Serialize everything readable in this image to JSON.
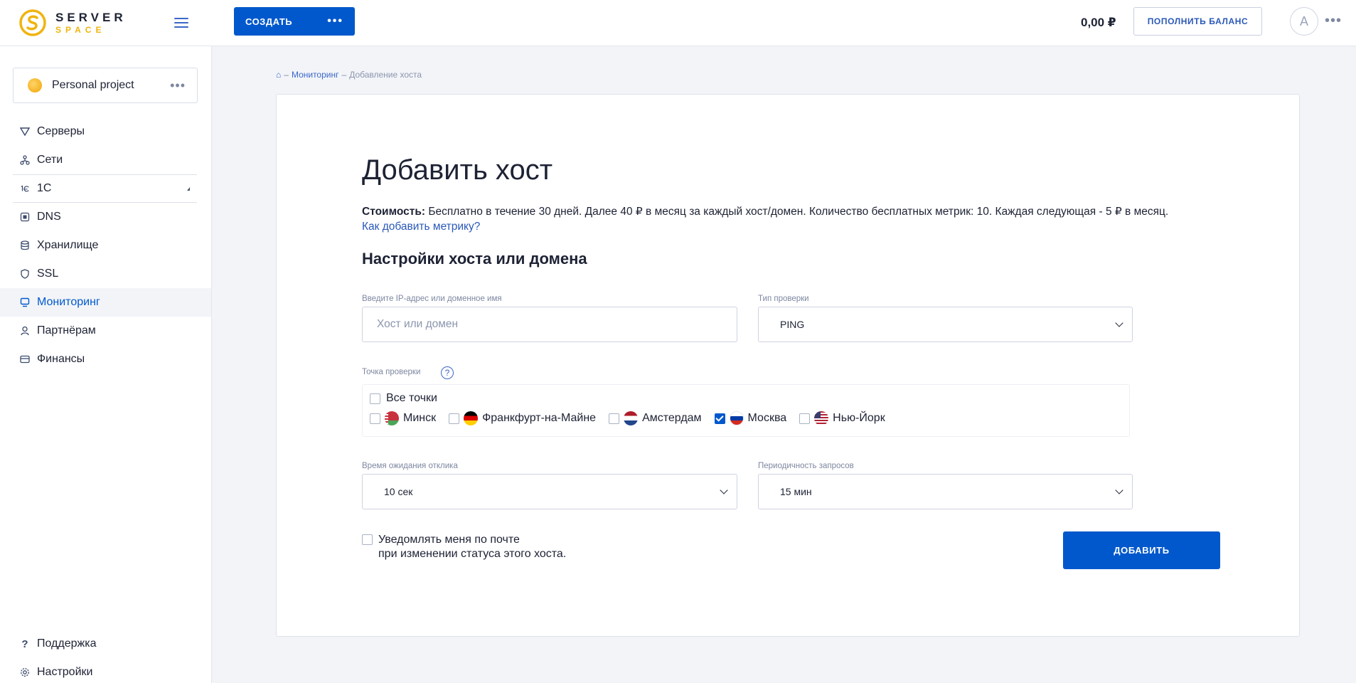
{
  "header": {
    "logo_top": "SERVER",
    "logo_bottom": "SPACE",
    "create_label": "СОЗДАТЬ",
    "create_more": "•••",
    "balance": "0,00 ₽",
    "topup_label": "ПОПОЛНИТЬ БАЛАНС",
    "avatar_letter": "A",
    "more": "•••"
  },
  "sidebar": {
    "project_name": "Personal project",
    "project_more": "•••",
    "items": [
      {
        "label": "Серверы",
        "icon": "servers-icon"
      },
      {
        "label": "Сети",
        "icon": "network-icon"
      },
      {
        "label": "1С",
        "icon": "1c-icon"
      },
      {
        "label": "DNS",
        "icon": "dns-icon"
      },
      {
        "label": "Хранилище",
        "icon": "storage-icon"
      },
      {
        "label": "SSL",
        "icon": "ssl-shield-icon"
      },
      {
        "label": "Мониторинг",
        "icon": "monitor-icon"
      },
      {
        "label": "Партнёрам",
        "icon": "partner-icon"
      },
      {
        "label": "Финансы",
        "icon": "card-icon"
      }
    ],
    "bottom_items": [
      {
        "label": "Поддержка",
        "icon": "help-icon"
      },
      {
        "label": "Настройки",
        "icon": "gear-icon"
      }
    ]
  },
  "breadcrumb": {
    "home_icon": "⌂",
    "sep": "–",
    "level1": "Мониторинг",
    "current": "Добавление хоста"
  },
  "main": {
    "title": "Добавить хост",
    "price_label": "Стоимость:",
    "price_text": " Бесплатно в течение 30 дней. Далее 40 ₽ в месяц за каждый хост/домен. Количество бесплатных метрик: 10. Каждая следующая - 5 ₽ в месяц.",
    "metric_link": "Как добавить метрику?",
    "section_title": "Настройки хоста или домена",
    "host_label": "Введите IP-адрес или доменное имя",
    "host_placeholder": "Хост или домен",
    "check_type_label": "Тип проверки",
    "check_type_value": "PING",
    "points_label": "Точка проверки",
    "help_glyph": "?",
    "all_points": "Все точки",
    "points": [
      {
        "label": "Минск",
        "flag": "flag-by",
        "checked": false
      },
      {
        "label": "Франкфурт-на-Майне",
        "flag": "flag-de",
        "checked": false
      },
      {
        "label": "Амстердам",
        "flag": "flag-nl",
        "checked": false
      },
      {
        "label": "Москва",
        "flag": "flag-ru",
        "checked": true
      },
      {
        "label": "Нью-Йорк",
        "flag": "flag-us",
        "checked": false
      }
    ],
    "timeout_label": "Время ожидания отклика",
    "timeout_value": "10 сек",
    "interval_label": "Периодичность запросов",
    "interval_value": "15 мин",
    "notify_line1": "Уведомлять меня по почте",
    "notify_line2": "при изменении статуса этого хоста.",
    "add_label": "ДОБАВИТЬ"
  },
  "colors": {
    "primary": "#0058cc",
    "link": "#2a58b8",
    "logo_accent": "#f0b40f"
  }
}
